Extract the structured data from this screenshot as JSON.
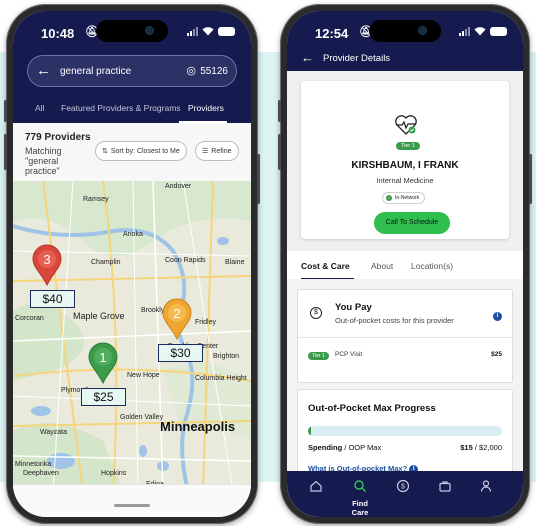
{
  "left_phone": {
    "status": {
      "time": "10:48"
    },
    "search": {
      "query": "general practice",
      "zip": "55126"
    },
    "tabs": [
      {
        "label": "All"
      },
      {
        "label": "Featured Providers & Programs"
      },
      {
        "label": "Providers",
        "active": true
      }
    ],
    "results": {
      "count_label": "779 Providers",
      "matching_label": "Matching \"general practice\"",
      "sort_label": "Sort by: Closest to Me",
      "refine_label": "Refine"
    },
    "map": {
      "city_labels": [
        "Ramsey",
        "Anoka",
        "Champlin",
        "Coon Rapids",
        "Blaine",
        "Brooklyn Park",
        "Fridley",
        "Brooklyn Center",
        "Brighton",
        "Plymouth",
        "New Hope",
        "Columbia Height",
        "Golden Valley",
        "Wayzata",
        "Minnetonka",
        "Deephaven",
        "Hopkins",
        "Edina",
        "Corcoran",
        "Maple Grove",
        "Andover"
      ],
      "major_city": "Minneapolis",
      "markers": [
        {
          "number": "3",
          "price": "$40",
          "color": "#d9473b"
        },
        {
          "number": "2",
          "price": "$30",
          "color": "#f0a531"
        },
        {
          "number": "1",
          "price": "$25",
          "color": "#3b9b4a"
        }
      ]
    }
  },
  "right_phone": {
    "status": {
      "time": "12:54"
    },
    "header": {
      "title": "Provider Details"
    },
    "provider": {
      "tier": "Tier 1",
      "name": "KIRSHBAUM, I FRANK",
      "specialty": "Internal Medicine",
      "network": "In-Network",
      "schedule_label": "Call To Schedule"
    },
    "tabs": [
      {
        "label": "Cost & Care",
        "active": true
      },
      {
        "label": "About"
      },
      {
        "label": "Location(s)"
      }
    ],
    "you_pay": {
      "title": "You Pay",
      "subtitle": "Out-of-pocket costs for this provider",
      "tier": "Tier 1",
      "visit_label": "PCP Visit",
      "visit_amount": "$25"
    },
    "oop": {
      "title": "Out-of-Pocket Max Progress",
      "progress_fraction": 0.0075,
      "spending_label": "Spending",
      "max_label": "OOP Max",
      "spent": "$15",
      "max": "$2,000",
      "link_label": "What is Out-of-pocket Max?"
    },
    "bottom_nav": [
      {
        "icon": "home-icon",
        "label": ""
      },
      {
        "icon": "search-icon",
        "label": "Find Care",
        "active": true
      },
      {
        "icon": "dollar-icon",
        "label": ""
      },
      {
        "icon": "briefcase-icon",
        "label": ""
      },
      {
        "icon": "person-icon",
        "label": ""
      }
    ]
  },
  "colors": {
    "navy": "#151a4f",
    "green": "#3b9b4a",
    "cta_green": "#2fbf4f",
    "teal_bg": "#dcf3f2",
    "link_blue": "#1e4fa3"
  }
}
